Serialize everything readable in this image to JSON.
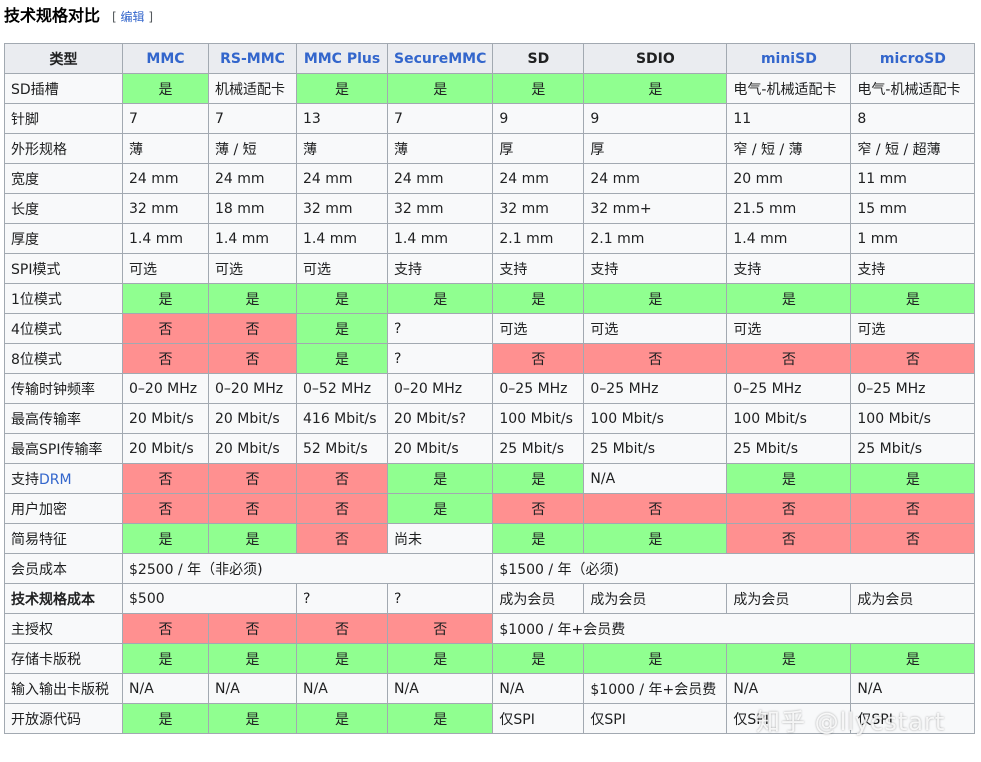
{
  "heading": {
    "title": "技术规格对比",
    "edit_open": "[",
    "edit_link": "编辑",
    "edit_close": "]"
  },
  "columns": [
    "类型",
    "MMC",
    "RS-MMC",
    "MMC Plus",
    "SecureMMC",
    "SD",
    "SDIO",
    "miniSD",
    "microSD"
  ],
  "rows": [
    {
      "label": "SD插槽",
      "cells": [
        [
          "是",
          "yes"
        ],
        [
          "机械适配卡",
          "n"
        ],
        [
          "是",
          "yes"
        ],
        [
          "是",
          "yes"
        ],
        [
          "是",
          "yes"
        ],
        [
          "是",
          "yes"
        ],
        [
          "电气-机械适配卡",
          "n"
        ],
        [
          "电气-机械适配卡",
          "n"
        ]
      ]
    },
    {
      "label": "针脚",
      "cells": [
        [
          "7",
          "n"
        ],
        [
          "7",
          "n"
        ],
        [
          "13",
          "n"
        ],
        [
          "7",
          "n"
        ],
        [
          "9",
          "n"
        ],
        [
          "9",
          "n"
        ],
        [
          "11",
          "n"
        ],
        [
          "8",
          "n"
        ]
      ]
    },
    {
      "label": "外形规格",
      "cells": [
        [
          "薄",
          "n"
        ],
        [
          "薄 / 短",
          "n"
        ],
        [
          "薄",
          "n"
        ],
        [
          "薄",
          "n"
        ],
        [
          "厚",
          "n"
        ],
        [
          "厚",
          "n"
        ],
        [
          "窄 / 短 / 薄",
          "n"
        ],
        [
          "窄 / 短 / 超薄",
          "n"
        ]
      ]
    },
    {
      "label": "宽度",
      "cells": [
        [
          "24 mm",
          "n"
        ],
        [
          "24 mm",
          "n"
        ],
        [
          "24 mm",
          "n"
        ],
        [
          "24 mm",
          "n"
        ],
        [
          "24 mm",
          "n"
        ],
        [
          "24 mm",
          "n"
        ],
        [
          "20 mm",
          "n"
        ],
        [
          "11 mm",
          "n"
        ]
      ]
    },
    {
      "label": "长度",
      "cells": [
        [
          "32 mm",
          "n"
        ],
        [
          "18 mm",
          "n"
        ],
        [
          "32 mm",
          "n"
        ],
        [
          "32 mm",
          "n"
        ],
        [
          "32 mm",
          "n"
        ],
        [
          "32 mm+",
          "n"
        ],
        [
          "21.5 mm",
          "n"
        ],
        [
          "15 mm",
          "n"
        ]
      ]
    },
    {
      "label": "厚度",
      "cells": [
        [
          "1.4 mm",
          "n"
        ],
        [
          "1.4 mm",
          "n"
        ],
        [
          "1.4 mm",
          "n"
        ],
        [
          "1.4 mm",
          "n"
        ],
        [
          "2.1 mm",
          "n"
        ],
        [
          "2.1 mm",
          "n"
        ],
        [
          "1.4 mm",
          "n"
        ],
        [
          "1 mm",
          "n"
        ]
      ]
    },
    {
      "label": "SPI模式",
      "cells": [
        [
          "可选",
          "n"
        ],
        [
          "可选",
          "n"
        ],
        [
          "可选",
          "n"
        ],
        [
          "支持",
          "n"
        ],
        [
          "支持",
          "n"
        ],
        [
          "支持",
          "n"
        ],
        [
          "支持",
          "n"
        ],
        [
          "支持",
          "n"
        ]
      ]
    },
    {
      "label": "1位模式",
      "cells": [
        [
          "是",
          "yes"
        ],
        [
          "是",
          "yes"
        ],
        [
          "是",
          "yes"
        ],
        [
          "是",
          "yes"
        ],
        [
          "是",
          "yes"
        ],
        [
          "是",
          "yes"
        ],
        [
          "是",
          "yes"
        ],
        [
          "是",
          "yes"
        ]
      ]
    },
    {
      "label": "4位模式",
      "cells": [
        [
          "否",
          "no"
        ],
        [
          "否",
          "no"
        ],
        [
          "是",
          "yes"
        ],
        [
          "?",
          "n"
        ],
        [
          "可选",
          "n"
        ],
        [
          "可选",
          "n"
        ],
        [
          "可选",
          "n"
        ],
        [
          "可选",
          "n"
        ]
      ]
    },
    {
      "label": "8位模式",
      "cells": [
        [
          "否",
          "no"
        ],
        [
          "否",
          "no"
        ],
        [
          "是",
          "yes"
        ],
        [
          "?",
          "n"
        ],
        [
          "否",
          "no"
        ],
        [
          "否",
          "no"
        ],
        [
          "否",
          "no"
        ],
        [
          "否",
          "no"
        ]
      ]
    },
    {
      "label": "传输时钟频率",
      "cells": [
        [
          "0–20 MHz",
          "n"
        ],
        [
          "0–20 MHz",
          "n"
        ],
        [
          "0–52 MHz",
          "n"
        ],
        [
          "0–20 MHz",
          "n"
        ],
        [
          "0–25 MHz",
          "n"
        ],
        [
          "0–25 MHz",
          "n"
        ],
        [
          "0–25 MHz",
          "n"
        ],
        [
          "0–25 MHz",
          "n"
        ]
      ]
    },
    {
      "label": "最高传输率",
      "cells": [
        [
          "20 Mbit/s",
          "n"
        ],
        [
          "20 Mbit/s",
          "n"
        ],
        [
          "416 Mbit/s",
          "n"
        ],
        [
          "20 Mbit/s?",
          "n"
        ],
        [
          "100 Mbit/s",
          "n"
        ],
        [
          "100 Mbit/s",
          "n"
        ],
        [
          "100 Mbit/s",
          "n"
        ],
        [
          "100 Mbit/s",
          "n"
        ]
      ]
    },
    {
      "label": "最高SPI传输率",
      "cells": [
        [
          "20 Mbit/s",
          "n"
        ],
        [
          "20 Mbit/s",
          "n"
        ],
        [
          "52 Mbit/s",
          "n"
        ],
        [
          "20 Mbit/s",
          "n"
        ],
        [
          "25 Mbit/s",
          "n"
        ],
        [
          "25 Mbit/s",
          "n"
        ],
        [
          "25 Mbit/s",
          "n"
        ],
        [
          "25 Mbit/s",
          "n"
        ]
      ]
    },
    {
      "label_prefix": "支持",
      "label_link": "DRM",
      "cells": [
        [
          "否",
          "no"
        ],
        [
          "否",
          "no"
        ],
        [
          "否",
          "no"
        ],
        [
          "是",
          "yes"
        ],
        [
          "是",
          "yes"
        ],
        [
          "N/A",
          "n"
        ],
        [
          "是",
          "yes"
        ],
        [
          "是",
          "yes"
        ]
      ]
    },
    {
      "label": "用户加密",
      "cells": [
        [
          "否",
          "no"
        ],
        [
          "否",
          "no"
        ],
        [
          "否",
          "no"
        ],
        [
          "是",
          "yes"
        ],
        [
          "否",
          "no"
        ],
        [
          "否",
          "no"
        ],
        [
          "否",
          "no"
        ],
        [
          "否",
          "no"
        ]
      ]
    },
    {
      "label": "简易特征",
      "cells": [
        [
          "是",
          "yes"
        ],
        [
          "是",
          "yes"
        ],
        [
          "否",
          "no"
        ],
        [
          "尚未",
          "n"
        ],
        [
          "是",
          "yes"
        ],
        [
          "是",
          "yes"
        ],
        [
          "否",
          "no"
        ],
        [
          "否",
          "no"
        ]
      ]
    },
    {
      "label": "会员成本",
      "cells": [
        [
          "$2500 / 年（非必须)",
          "n",
          4
        ],
        [
          "$1500 / 年（必须)",
          "n",
          4
        ]
      ]
    },
    {
      "label": "技术规格成本",
      "bold": true,
      "cells": [
        [
          "$500",
          "n",
          2
        ],
        [
          "?",
          "n"
        ],
        [
          "?",
          "n"
        ],
        [
          "成为会员",
          "n"
        ],
        [
          "成为会员",
          "n"
        ],
        [
          "成为会员",
          "n"
        ],
        [
          "成为会员",
          "n"
        ]
      ]
    },
    {
      "label": "主授权",
      "cells": [
        [
          "否",
          "no"
        ],
        [
          "否",
          "no"
        ],
        [
          "否",
          "no"
        ],
        [
          "否",
          "no"
        ],
        [
          "$1000 / 年+会员费",
          "n",
          4
        ]
      ]
    },
    {
      "label": "存储卡版税",
      "cells": [
        [
          "是",
          "yes"
        ],
        [
          "是",
          "yes"
        ],
        [
          "是",
          "yes"
        ],
        [
          "是",
          "yes"
        ],
        [
          "是",
          "yes"
        ],
        [
          "是",
          "yes"
        ],
        [
          "是",
          "yes"
        ],
        [
          "是",
          "yes"
        ]
      ]
    },
    {
      "label": "输入输出卡版税",
      "cells": [
        [
          "N/A",
          "n"
        ],
        [
          "N/A",
          "n"
        ],
        [
          "N/A",
          "n"
        ],
        [
          "N/A",
          "n"
        ],
        [
          "N/A",
          "n"
        ],
        [
          "$1000 / 年+会员费",
          "n"
        ],
        [
          "N/A",
          "n"
        ],
        [
          "N/A",
          "n"
        ]
      ]
    },
    {
      "label": "开放源代码",
      "cells": [
        [
          "是",
          "yes"
        ],
        [
          "是",
          "yes"
        ],
        [
          "是",
          "yes"
        ],
        [
          "是",
          "yes"
        ],
        [
          "仅SPI",
          "n"
        ],
        [
          "仅SPI",
          "n"
        ],
        [
          "仅SPI",
          "n"
        ],
        [
          "仅SPI",
          "n"
        ]
      ]
    }
  ],
  "watermark": "知乎 @llycstart",
  "colors": {
    "yes": "#90ff90",
    "no": "#ff9090",
    "header_bg": "#eaecf0",
    "cell_bg": "#f8f9fa",
    "link": "#3366cc",
    "border": "#a2a9b1"
  }
}
